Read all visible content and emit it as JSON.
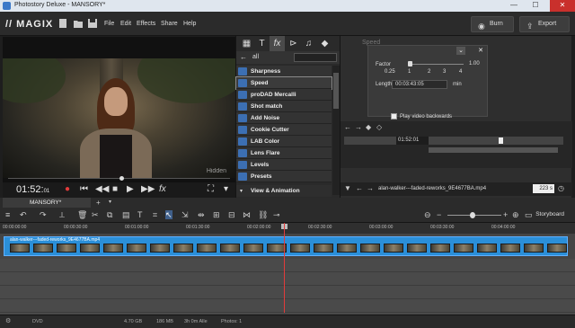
{
  "window": {
    "title": "Photostory Deluxe - MANSORY*",
    "minimize": "—",
    "maximize": "☐",
    "close": "✕"
  },
  "menubar": {
    "logo": "// MAGIX",
    "menus": [
      "File",
      "Edit",
      "Effects",
      "Share",
      "Help"
    ],
    "burn_label": "Burn",
    "export_label": "Export"
  },
  "preview": {
    "watermark": "Hidden",
    "timecode_main": "01:52:",
    "timecode_frames": "01"
  },
  "effects": {
    "filter_label": "all",
    "items": [
      {
        "label": "Sharpness",
        "active": false
      },
      {
        "label": "Speed",
        "active": true
      },
      {
        "label": "proDAD Mercalli",
        "active": false
      },
      {
        "label": "Shot match",
        "active": false
      },
      {
        "label": "Add Noise",
        "active": false
      },
      {
        "label": "Cookie Cutter",
        "active": false
      },
      {
        "label": "LAB Color",
        "active": false
      },
      {
        "label": "Lens Flare",
        "active": false
      },
      {
        "label": "Levels",
        "active": false
      },
      {
        "label": "Presets",
        "active": false
      }
    ],
    "footer_label": "View & Animation"
  },
  "speed_panel": {
    "title": "Speed",
    "factor_label": "Factor",
    "factor_max": "1.00",
    "scale": [
      "0.25",
      "1",
      "2",
      "3",
      "4"
    ],
    "length_label": "Length",
    "length_value": "00:03:43:05",
    "length_unit": "min",
    "checkbox_label": "Play video backwards",
    "checkbox_checked": false,
    "timeline_time": "01:52:01",
    "file_name": "alan-walker---faded-reworks_9E4677BA.mp4",
    "file_seconds": "223 s"
  },
  "project": {
    "tab_label": "MANSORY*",
    "storyboard_label": "Storyboard"
  },
  "ruler": {
    "ticks": [
      "00:00:00:00",
      "00:00:30:00",
      "00:01:00:00",
      "00:01:30:00",
      "00:02:00:00",
      "00:02:30:00",
      "00:03:00:00",
      "00:03:30:00",
      "00:04:00:00"
    ]
  },
  "timeline": {
    "clip_label": "alan-walker---faded-reworks_9E4677BA.mp4"
  },
  "status": {
    "medium": "DVD",
    "size": "4.70 GB",
    "used": "186 MB",
    "duration": "3h 0m Alle",
    "photos": "Photos: 1"
  },
  "colors": {
    "accent": "#2b8fd8",
    "record": "#e23b3b",
    "panel": "#2a2a2a"
  }
}
